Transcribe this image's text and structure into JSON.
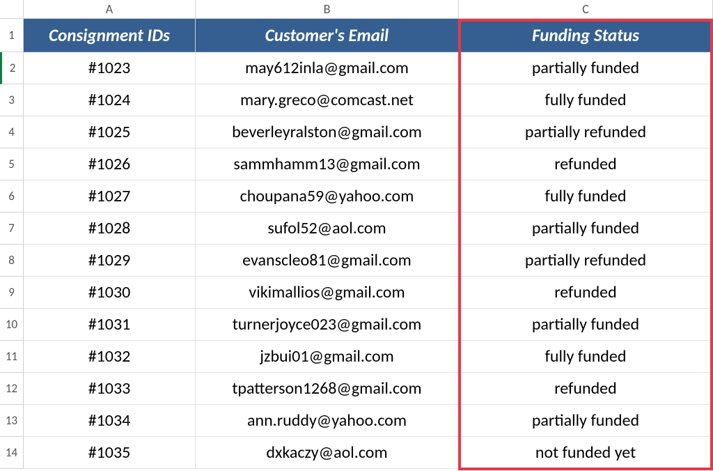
{
  "columns": [
    "A",
    "B",
    "C"
  ],
  "rowNumbers": [
    "1",
    "2",
    "3",
    "4",
    "5",
    "6",
    "7",
    "8",
    "9",
    "10",
    "11",
    "12",
    "13",
    "14"
  ],
  "header": {
    "colA": "Consignment IDs",
    "colB": "Customer's Email",
    "colC": "Funding Status"
  },
  "rows": [
    {
      "id": "#1023",
      "email": "may612inla@gmail.com",
      "status": "partially funded"
    },
    {
      "id": "#1024",
      "email": "mary.greco@comcast.net",
      "status": "fully funded"
    },
    {
      "id": "#1025",
      "email": "beverleyralston@gmail.com",
      "status": "partially refunded"
    },
    {
      "id": "#1026",
      "email": "sammhamm13@gmail.com",
      "status": "refunded"
    },
    {
      "id": "#1027",
      "email": "choupana59@yahoo.com",
      "status": "fully funded"
    },
    {
      "id": "#1028",
      "email": "sufol52@aol.com",
      "status": "partially funded"
    },
    {
      "id": "#1029",
      "email": "evanscleo81@gmail.com",
      "status": "partially refunded"
    },
    {
      "id": "#1030",
      "email": "vikimallios@gmail.com",
      "status": "refunded"
    },
    {
      "id": "#1031",
      "email": "turnerjoyce023@gmail.com",
      "status": "partially funded"
    },
    {
      "id": "#1032",
      "email": "jzbui01@gmail.com",
      "status": "fully funded"
    },
    {
      "id": "#1033",
      "email": "tpatterson1268@gmail.com",
      "status": "refunded"
    },
    {
      "id": "#1034",
      "email": "ann.ruddy@yahoo.com",
      "status": "partially funded"
    },
    {
      "id": "#1035",
      "email": "dxkaczy@aol.com",
      "status": "not funded yet"
    }
  ],
  "selectedRow": 2,
  "highlightColumn": "C",
  "colors": {
    "headerBg": "#365F91",
    "headerFg": "#ffffff",
    "highlightBorder": "#e63946"
  }
}
